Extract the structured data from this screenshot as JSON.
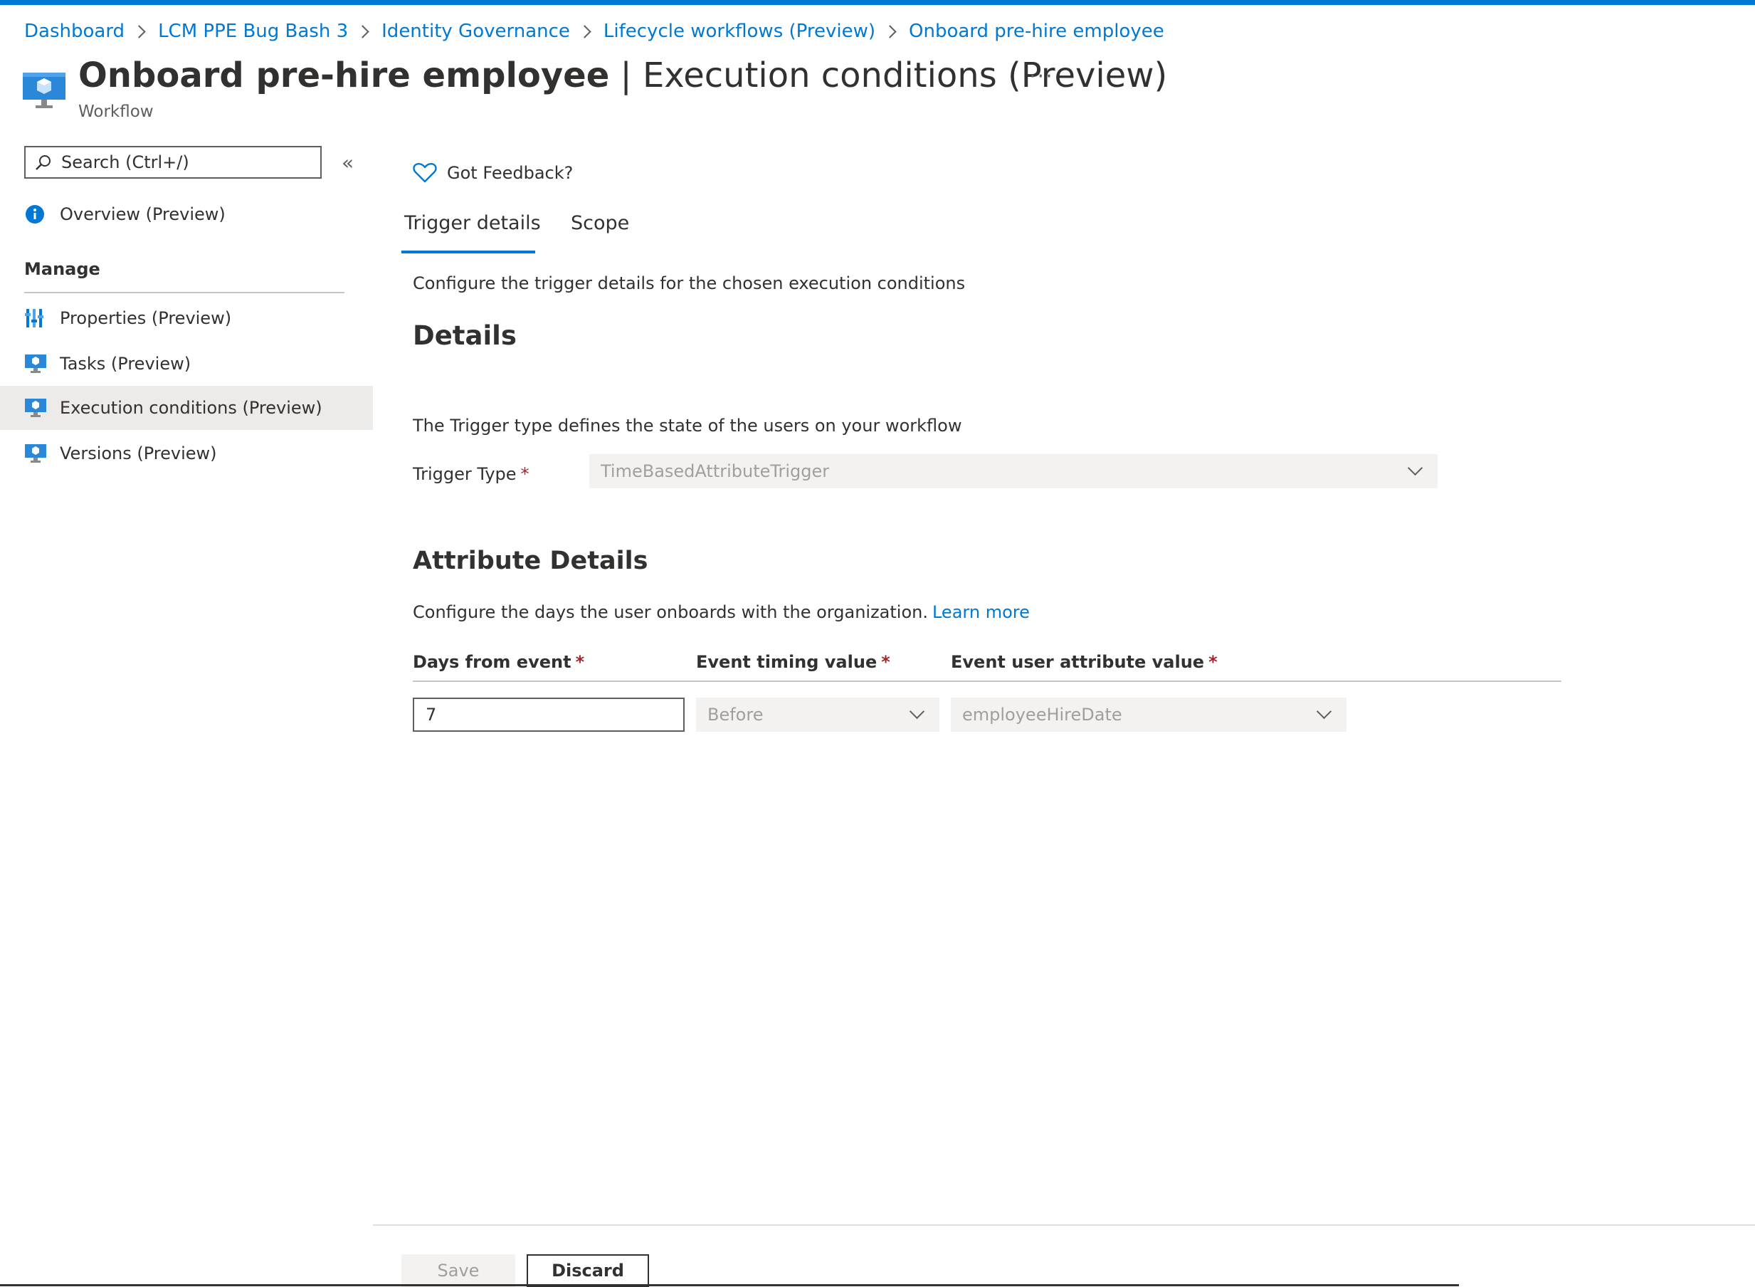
{
  "breadcrumb": [
    {
      "label": "Dashboard"
    },
    {
      "label": "LCM PPE Bug Bash 3"
    },
    {
      "label": "Identity Governance"
    },
    {
      "label": "Lifecycle workflows (Preview)"
    },
    {
      "label": "Onboard pre-hire employee"
    }
  ],
  "header": {
    "title_bold": "Onboard pre-hire employee",
    "title_rest": " | Execution conditions (Preview)",
    "subtitle": "Workflow",
    "more": "···"
  },
  "sidebar": {
    "search_placeholder": "Search (Ctrl+/)",
    "collapse": "«",
    "overview": "Overview (Preview)",
    "section": "Manage",
    "items": [
      {
        "label": "Properties (Preview)"
      },
      {
        "label": "Tasks (Preview)"
      },
      {
        "label": "Execution conditions (Preview)"
      },
      {
        "label": "Versions (Preview)"
      }
    ]
  },
  "main": {
    "feedback": "Got Feedback?",
    "tabs": [
      {
        "label": "Trigger details"
      },
      {
        "label": "Scope"
      }
    ],
    "tab_description": "Configure the trigger details for the chosen execution conditions",
    "details_heading": "Details",
    "trigger_description": "The Trigger type defines the state of the users on your workflow",
    "trigger_label": "Trigger Type",
    "required": "*",
    "trigger_value": "TimeBasedAttributeTrigger",
    "attribute_heading": "Attribute Details",
    "attribute_description": "Configure the days the user onboards with the organization.",
    "learn_more": "Learn more",
    "columns": [
      "Days from event",
      "Event timing value",
      "Event user attribute value"
    ],
    "days_value": "7",
    "timing_value": "Before",
    "attribute_value": "employeeHireDate"
  },
  "footer": {
    "save": "Save",
    "discard": "Discard"
  },
  "colors": {
    "accent": "#0078d4",
    "required": "#a4262c",
    "selected_bg": "#edebe9"
  }
}
